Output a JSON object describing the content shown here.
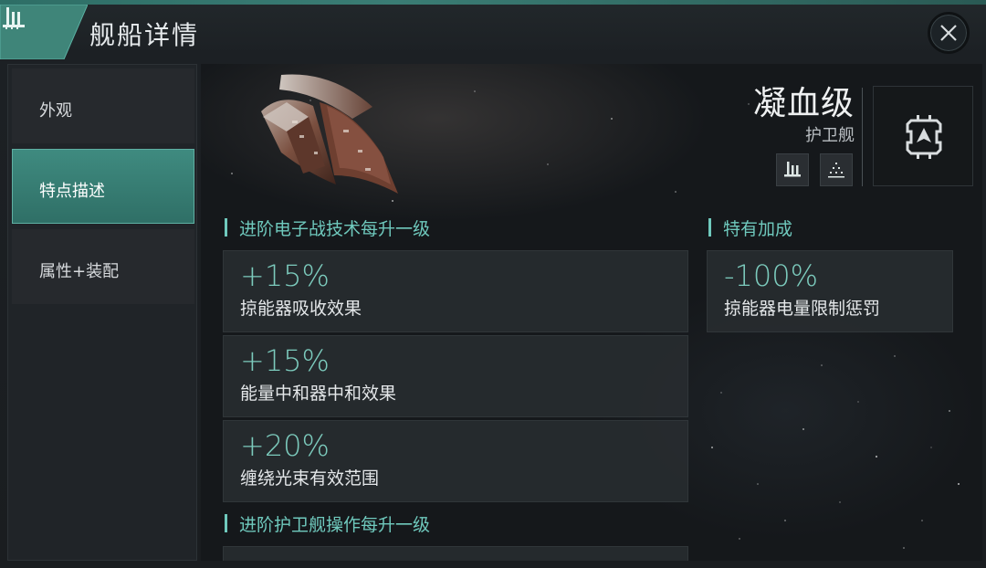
{
  "header": {
    "title": "舰船详情",
    "ship_type_icon": "ship-silhouette-icon",
    "close_icon": "close-icon"
  },
  "sidebar": {
    "items": [
      {
        "label": "外观",
        "active": false
      },
      {
        "label": "特点描述",
        "active": true
      },
      {
        "label": "属性+装配",
        "active": false
      }
    ]
  },
  "ship": {
    "name": "凝血级",
    "class": "护卫舰",
    "icons": [
      "ship-silhouette-icon",
      "dots-formation-icon"
    ],
    "faction_icon": "faction-emblem-icon"
  },
  "sections": [
    {
      "title": "进阶电子战技术每升一级",
      "bonuses": [
        {
          "value": "+15%",
          "desc": "掠能器吸收效果"
        },
        {
          "value": "+15%",
          "desc": "能量中和器中和效果"
        },
        {
          "value": "+20%",
          "desc": "缠绕光束有效范围"
        }
      ]
    },
    {
      "title": "特有加成",
      "bonuses": [
        {
          "value": "-100%",
          "desc": "掠能器电量限制惩罚"
        }
      ]
    },
    {
      "title": "进阶护卫舰操作每升一级",
      "bonuses": []
    }
  ],
  "colors": {
    "accent": "#6fc9bd",
    "active_tab": "#3a8277",
    "bonus_value": "#7ccbbd"
  }
}
